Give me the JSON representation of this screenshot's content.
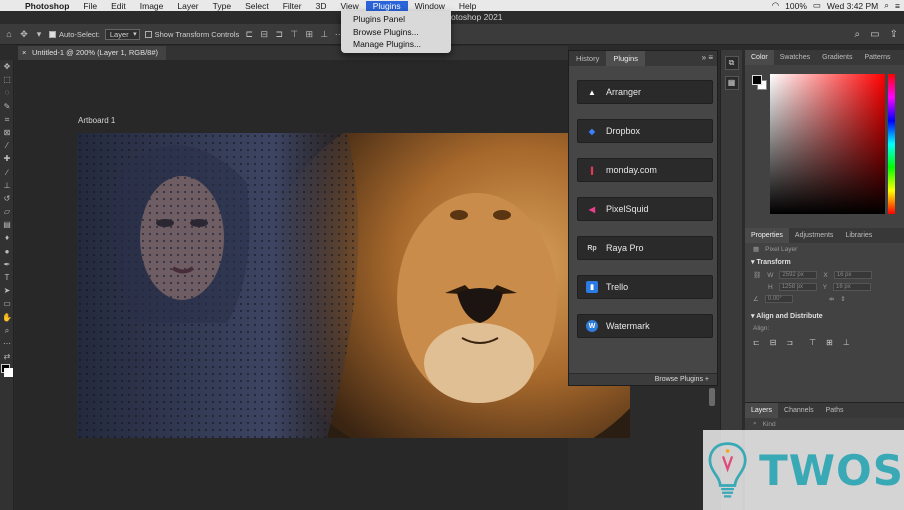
{
  "menubar": {
    "app": "Photoshop",
    "items": [
      "File",
      "Edit",
      "Image",
      "Layer",
      "Type",
      "Select",
      "Filter",
      "3D",
      "View",
      "Plugins",
      "Window",
      "Help"
    ],
    "active": "Plugins",
    "battery": "100%",
    "clock": "Wed 3:42 PM"
  },
  "window_title": "otoshop 2021",
  "plugins_menu": [
    "Plugins Panel",
    "Browse Plugins...",
    "Manage Plugins..."
  ],
  "options_bar": {
    "auto_select_label": "Auto-Select:",
    "auto_select_value": "Layer",
    "transform_label": "Show Transform Controls"
  },
  "document_tab": "Untitled-1 @ 200% (Layer 1, RGB/8#)",
  "artboard_label": "Artboard 1",
  "plugin_panel": {
    "tabs": [
      "History",
      "Plugins"
    ],
    "active_tab": "Plugins",
    "plugins": [
      {
        "label": "Arranger",
        "icon": "arranger-icon",
        "color": "#ffffff"
      },
      {
        "label": "Dropbox",
        "icon": "dropbox-icon",
        "color": "#3d7fff"
      },
      {
        "label": "monday.com",
        "icon": "monday-icon",
        "color": "#ff3d57"
      },
      {
        "label": "PixelSquid",
        "icon": "pixelsquid-icon",
        "color": "#e83e8c"
      },
      {
        "label": "Raya Pro",
        "icon": "raya-pro-icon",
        "color": "#cfcfcf"
      },
      {
        "label": "Trello",
        "icon": "trello-icon",
        "color": "#2b7be4"
      },
      {
        "label": "Watermark",
        "icon": "watermark-icon",
        "color": "#2e7ddc"
      }
    ],
    "footer": "Browse Plugins"
  },
  "color_panel": {
    "tabs": [
      "Color",
      "Swatches",
      "Gradients",
      "Patterns"
    ],
    "active_tab": "Color"
  },
  "properties_panel": {
    "tabs": [
      "Properties",
      "Adjustments",
      "Libraries"
    ],
    "active_tab": "Properties",
    "layer_type": "Pixel Layer",
    "transform_title": "Transform",
    "w": "2592 px",
    "x": "16 px",
    "h": "1258 px",
    "y": "16 px",
    "angle": "0.00°",
    "align_title": "Align and Distribute",
    "align_label": "Align:"
  },
  "layers_panel": {
    "tabs": [
      "Layers",
      "Channels",
      "Paths"
    ],
    "active_tab": "Layers",
    "filter": "Kind"
  },
  "watermark_brand": "TWOS"
}
